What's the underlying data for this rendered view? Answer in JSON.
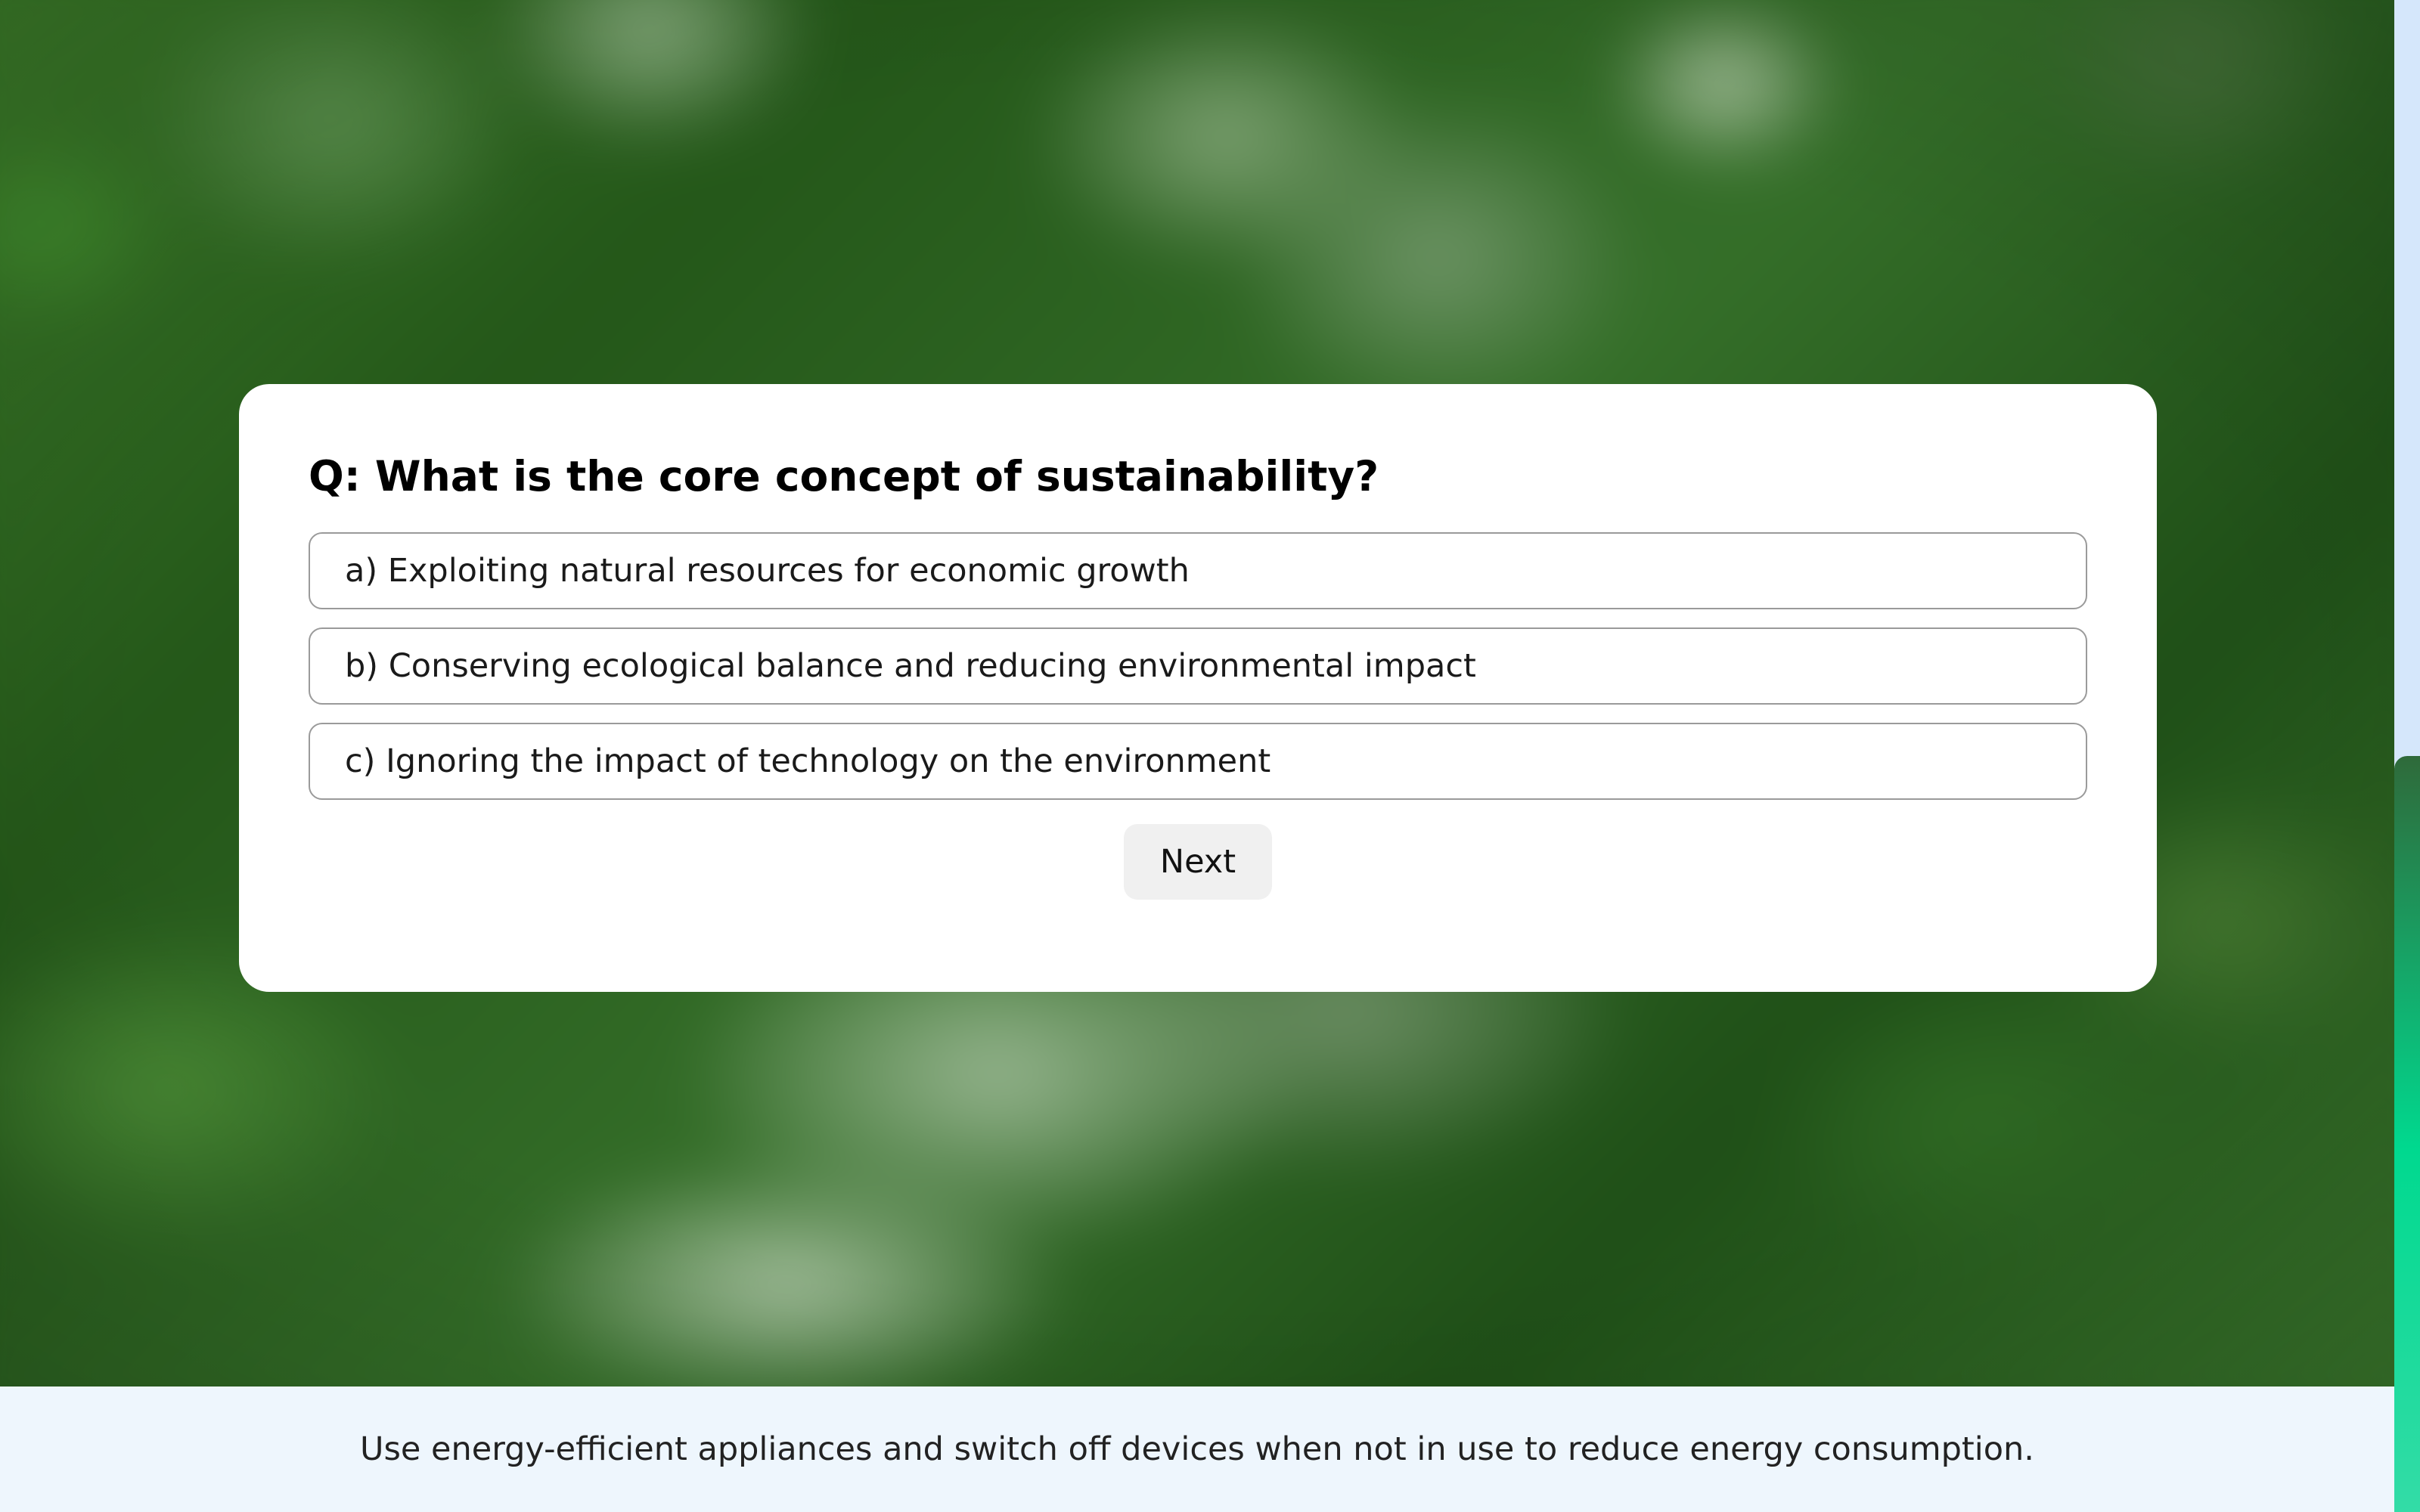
{
  "quiz": {
    "question": "Q: What is the core concept of sustainability?",
    "options": [
      {
        "label": "a) Exploiting natural resources for economic growth"
      },
      {
        "label": "b) Conserving ecological balance and reducing environmental impact"
      },
      {
        "label": "c) Ignoring the impact of technology on the environment"
      }
    ],
    "next_label": "Next"
  },
  "footer": {
    "tip": "Use energy-efficient appliances and switch off devices when not in use to reduce energy consumption."
  },
  "colors": {
    "background_theme": "#2f6a26",
    "footer_background": "#eef6fd",
    "scrollbar_track": "#d5e7fb",
    "scrollbar_thumb_accent": "#00d98f"
  },
  "scroll": {
    "position_fraction": 1.0
  }
}
